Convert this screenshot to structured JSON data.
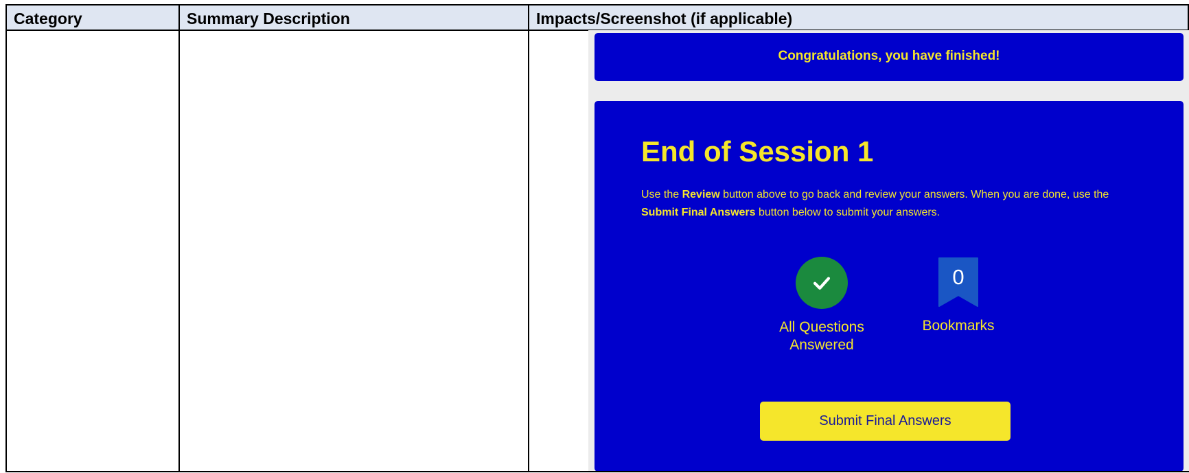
{
  "table": {
    "headers": {
      "category": "Category",
      "summary": "Summary Description",
      "impacts": "Impacts/Screenshot (if applicable)"
    }
  },
  "screenshot": {
    "banner": "Congratulations, you have finished!",
    "title": "End of Session 1",
    "description": {
      "part1": "Use the ",
      "review": "Review",
      "part2": " button above to go back and review your answers. When you are done, use the ",
      "submit": "Submit Final Answers",
      "part3": " button below to submit your answers."
    },
    "stats": {
      "answered_label": "All Questions Answered",
      "bookmarks_count": "0",
      "bookmarks_label": "Bookmarks"
    },
    "submit_button": "Submit Final Answers"
  },
  "colors": {
    "panel": "#0000cc",
    "accent_yellow": "#f5e62b",
    "check_green": "#1b8a3e",
    "bookmark_blue": "#1a56c4",
    "header_bg": "#dfe6f2"
  },
  "icons": [
    "check-icon",
    "bookmark-icon"
  ]
}
